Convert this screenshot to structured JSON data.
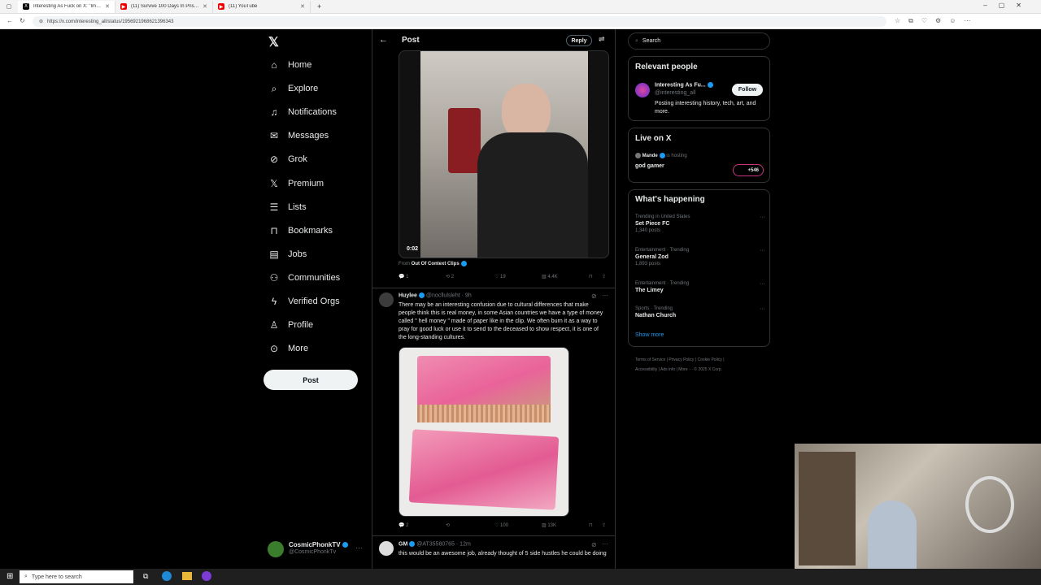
{
  "browser": {
    "tabs": [
      {
        "title": "Interesting As Fuck on X: \"Imagin",
        "active": true
      },
      {
        "title": "(11) Survive 100 Days In Prison W",
        "active": false
      },
      {
        "title": "(11) YouTube",
        "active": false
      }
    ],
    "url": "https://x.com/interesting_all/status/1956921968621396343"
  },
  "sidebar": {
    "items": [
      {
        "label": "Home",
        "icon": "home-icon"
      },
      {
        "label": "Explore",
        "icon": "search-icon"
      },
      {
        "label": "Notifications",
        "icon": "bell-icon"
      },
      {
        "label": "Messages",
        "icon": "mail-icon"
      },
      {
        "label": "Grok",
        "icon": "grok-icon"
      },
      {
        "label": "Premium",
        "icon": "x-logo-icon"
      },
      {
        "label": "Lists",
        "icon": "list-icon"
      },
      {
        "label": "Bookmarks",
        "icon": "bookmark-icon"
      },
      {
        "label": "Jobs",
        "icon": "briefcase-icon"
      },
      {
        "label": "Communities",
        "icon": "people-icon"
      },
      {
        "label": "Verified Orgs",
        "icon": "lightning-icon"
      },
      {
        "label": "Profile",
        "icon": "person-icon"
      },
      {
        "label": "More",
        "icon": "more-circle-icon"
      }
    ],
    "post_label": "Post",
    "account": {
      "name": "CosmicPhonkTV",
      "handle": "@CosmicPhonkTv"
    }
  },
  "header": {
    "title": "Post",
    "reply_label": "Reply"
  },
  "video": {
    "time": "0:02",
    "from_prefix": "From",
    "from_name": "Out Of Context Clips"
  },
  "video_stats": {
    "replies": "1",
    "reposts": "2",
    "likes": "19",
    "views": "4.4K"
  },
  "reply1": {
    "name": "Huylee",
    "handle": "@nocllulsleht",
    "time": "9h",
    "text": "There may be an interesting confusion due to cultural differences that make people think this is real money, in some Asian countries we have a type of money called \" hell money \" made of paper like in the clip. We often burn it as a way to pray for good luck or use it to send to the deceased to show respect, it is one of the long-standing cultures.",
    "stats": {
      "replies": "2",
      "likes": "100",
      "views": "13K"
    }
  },
  "reply2": {
    "name": "GM",
    "handle": "@AT35580765",
    "time": "12m",
    "text": "this would be an awesome job, already thought of 5 side hustles he could be doing"
  },
  "right": {
    "search_placeholder": "Search",
    "relevant_title": "Relevant people",
    "person": {
      "name": "Interesting As Fu...",
      "handle": "@interesting_all",
      "bio": "Posting interesting history, tech, art, and more.",
      "follow_label": "Follow"
    },
    "live_title": "Live on X",
    "live": {
      "host": "Mande",
      "hosting": "is hosting",
      "title": "god gamer",
      "count": "+546"
    },
    "happening_title": "What's happening",
    "trends": [
      {
        "context": "Trending in United States",
        "name": "Set Piece FC",
        "posts": "1,340 posts"
      },
      {
        "context": "Entertainment · Trending",
        "name": "General Zod",
        "posts": "1,893 posts"
      },
      {
        "context": "Entertainment · Trending",
        "name": "The Limey",
        "posts": ""
      },
      {
        "context": "Sports · Trending",
        "name": "Nathan Church",
        "posts": ""
      }
    ],
    "show_more": "Show more",
    "footer": [
      "Terms of Service",
      "Privacy Policy",
      "Cookie Policy",
      "Accessibility",
      "Ads info",
      "More ···",
      "© 2025 X Corp."
    ]
  },
  "taskbar": {
    "search_placeholder": "Type here to search"
  },
  "colors": {
    "accent": "#1d9bf0",
    "bg": "#000000",
    "border": "#2f3336",
    "muted": "#71767b"
  }
}
